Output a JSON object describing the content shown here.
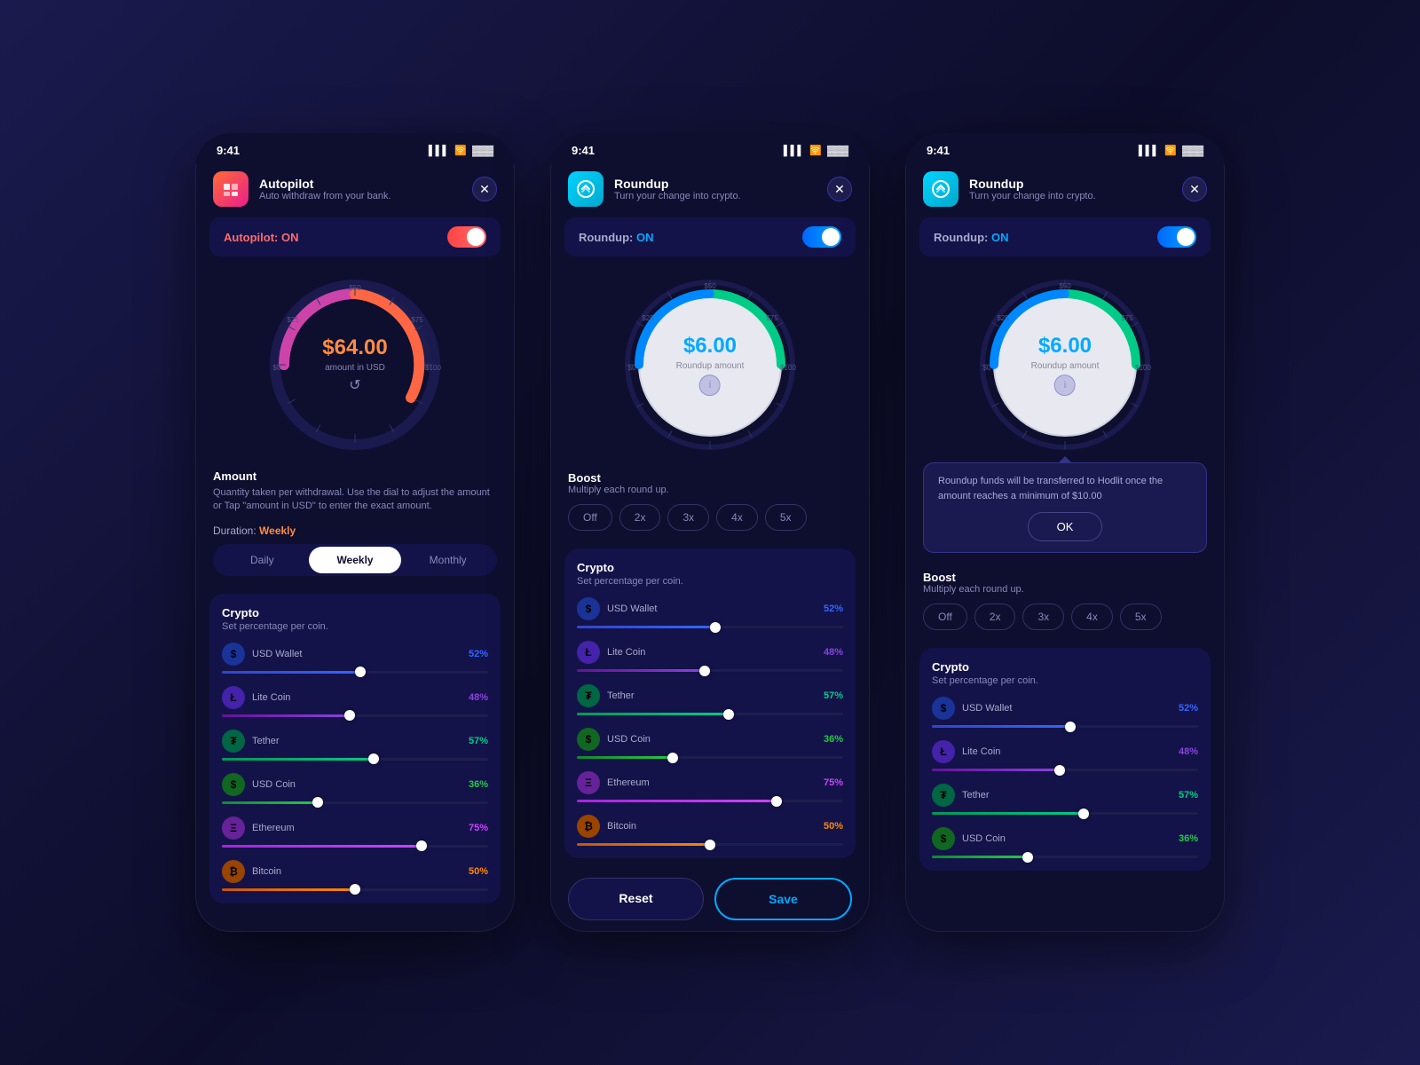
{
  "colors": {
    "bg": "#0e0e2e",
    "accent_orange": "#ff8c42",
    "accent_blue": "#00aaff",
    "accent_red": "#ff4444",
    "accent_green": "#00cc88",
    "text_primary": "#ffffff",
    "text_secondary": "#8888bb"
  },
  "phone1": {
    "status_time": "9:41",
    "app_name": "Autopilot",
    "app_desc": "Auto withdraw from your bank.",
    "toggle_label": "Autopilot:",
    "toggle_state": "ON",
    "toggle_color": "red",
    "dial_amount": "$64.00",
    "dial_sub": "amount in USD",
    "amount_title": "Amount",
    "amount_desc": "Quantity taken per withdrawal. Use the dial to adjust the amount or Tap \"amount in USD\" to enter the exact amount.",
    "duration_label": "Duration:",
    "duration_value": "Weekly",
    "tabs": [
      "Daily",
      "Weekly",
      "Monthly"
    ],
    "active_tab": 1
  },
  "phone2": {
    "status_time": "9:41",
    "app_name": "Roundup",
    "app_desc": "Turn your change into crypto.",
    "toggle_label": "Roundup:",
    "toggle_state": "ON",
    "toggle_color": "blue",
    "dial_amount": "$6.00",
    "dial_sub": "Roundup amount",
    "boost_title": "Boost",
    "boost_sub": "Multiply each round up.",
    "boost_buttons": [
      "Off",
      "2x",
      "3x",
      "4x",
      "5x"
    ],
    "crypto_title": "Crypto",
    "crypto_sub": "Set percentage per coin.",
    "bottom_reset": "Reset",
    "bottom_save": "Save"
  },
  "phone3": {
    "status_time": "9:41",
    "app_name": "Roundup",
    "app_desc": "Turn your change into crypto.",
    "toggle_label": "Roundup:",
    "toggle_state": "ON",
    "toggle_color": "blue",
    "dial_amount": "$6.00",
    "dial_sub": "Roundup amount",
    "tooltip_text": "Roundup funds will be transferred to Hodlit once the amount reaches a minimum of $10.00",
    "tooltip_ok": "OK",
    "boost_title": "Boost",
    "boost_sub": "Multiply each round up.",
    "boost_buttons": [
      "Off",
      "2x",
      "3x",
      "4x",
      "5x"
    ]
  },
  "crypto_coins": [
    {
      "name": "USD Wallet",
      "pct": "52%",
      "pct_num": 52,
      "color": "#3366ff",
      "icon": "$",
      "icon_bg": "#1a3399",
      "track": "#3366ff"
    },
    {
      "name": "Lite Coin",
      "pct": "48%",
      "pct_num": 48,
      "color": "#8844dd",
      "icon": "Ł",
      "icon_bg": "#4422aa",
      "track": "#8844dd"
    },
    {
      "name": "Tether",
      "pct": "57%",
      "pct_num": 57,
      "color": "#00cc88",
      "icon": "₮",
      "icon_bg": "#006644",
      "track": "#00cc88"
    },
    {
      "name": "USD Coin",
      "pct": "36%",
      "pct_num": 36,
      "color": "#22cc44",
      "icon": "$",
      "icon_bg": "#116622",
      "track": "#22cc44"
    },
    {
      "name": "Ethereum",
      "pct": "75%",
      "pct_num": 75,
      "color": "#cc44ff",
      "icon": "Ξ",
      "icon_bg": "#662299",
      "track": "#cc44ff"
    },
    {
      "name": "Bitcoin",
      "pct": "50%",
      "pct_num": 50,
      "color": "#ff8800",
      "icon": "₿",
      "icon_bg": "#994400",
      "track": "#ff8800"
    }
  ]
}
